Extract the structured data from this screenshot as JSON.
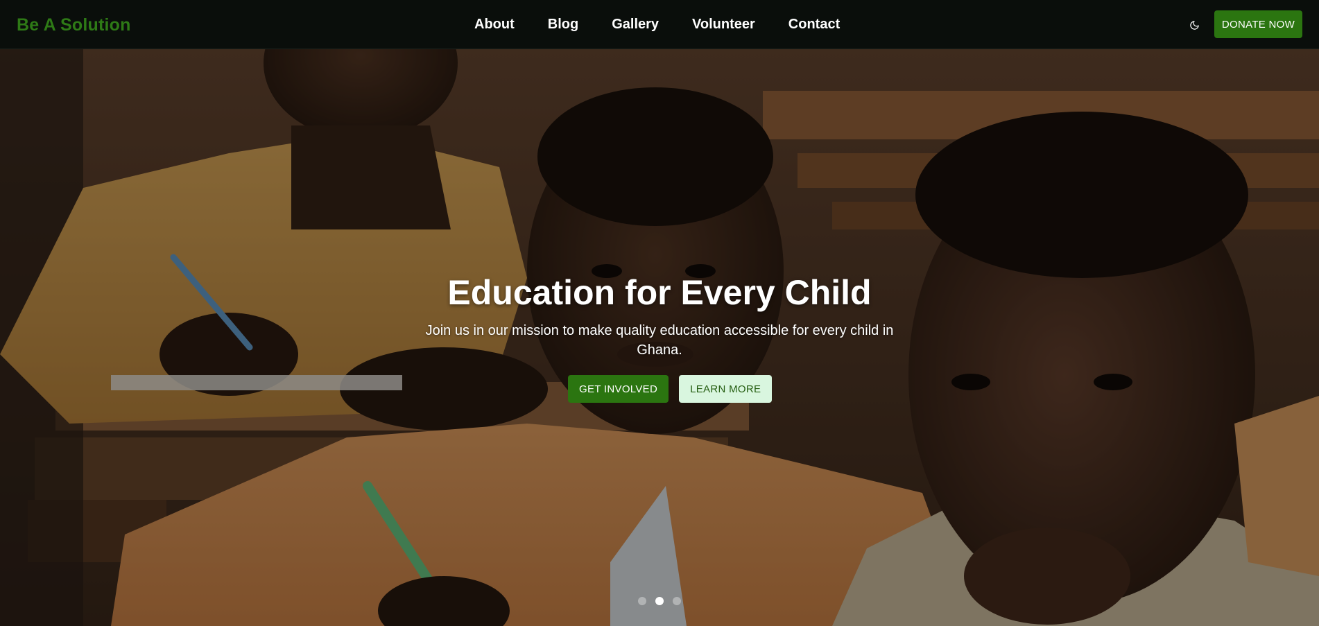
{
  "brand": {
    "name": "Be A Solution"
  },
  "nav": {
    "links": [
      {
        "label": "About"
      },
      {
        "label": "Blog"
      },
      {
        "label": "Gallery"
      },
      {
        "label": "Volunteer"
      },
      {
        "label": "Contact"
      }
    ],
    "theme_toggle_icon": "moon-icon",
    "donate_label": "DONATE NOW"
  },
  "hero": {
    "title": "Education for Every Child",
    "subtitle": "Join us in our mission to make quality education accessible for every child in Ghana.",
    "primary_button": "GET INVOLVED",
    "secondary_button": "LEARN MORE",
    "carousel": {
      "slide_count": 3,
      "active_index": 1
    }
  },
  "colors": {
    "brand_green": "#2e7a16",
    "button_green": "#2b7510",
    "secondary_button_bg": "#d9f6df",
    "navbar_bg": "#0a0e0b"
  }
}
